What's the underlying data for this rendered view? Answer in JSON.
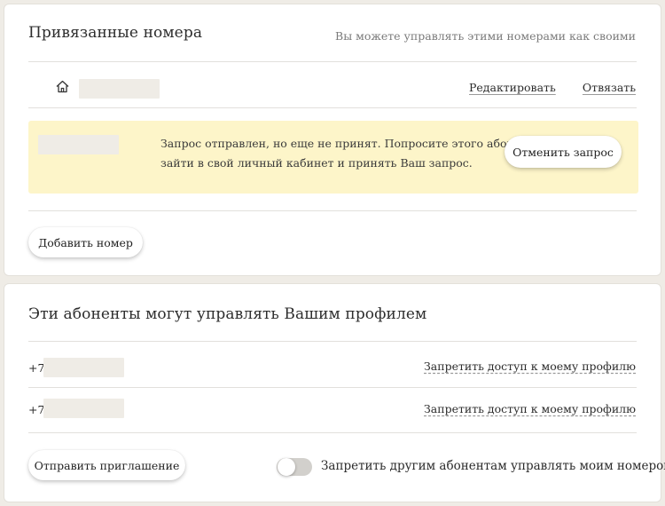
{
  "linked_numbers": {
    "title": "Привязанные номера",
    "hint": "Вы можете управлять этими номерами как своими",
    "row": {
      "home_icon": "home-icon",
      "edit_label": "Редактировать",
      "unlink_label": "Отвязать"
    },
    "pending": {
      "message_line1": "Запрос отправлен, но еще не принят. Попросите этого абонента",
      "message_line2": "зайти в свой личный кабинет и принять Ваш запрос.",
      "cancel_label": "Отменить запрос"
    },
    "add_label": "Добавить номер"
  },
  "managers": {
    "title": "Эти абоненты могут управлять Вашим профилем",
    "rows": [
      {
        "prefix": "+7",
        "deny_label": "Запретить доступ к моему профилю"
      },
      {
        "prefix": "+7",
        "deny_label": "Запретить доступ к моему профилю"
      }
    ],
    "invite_label": "Отправить приглашение",
    "toggle_label": "Запретить другим абонентам управлять моим номером",
    "toggle_on": false
  },
  "colors": {
    "page_bg": "#efece6",
    "notice_bg": "#fdf5c9",
    "placeholder": "#efece6"
  }
}
